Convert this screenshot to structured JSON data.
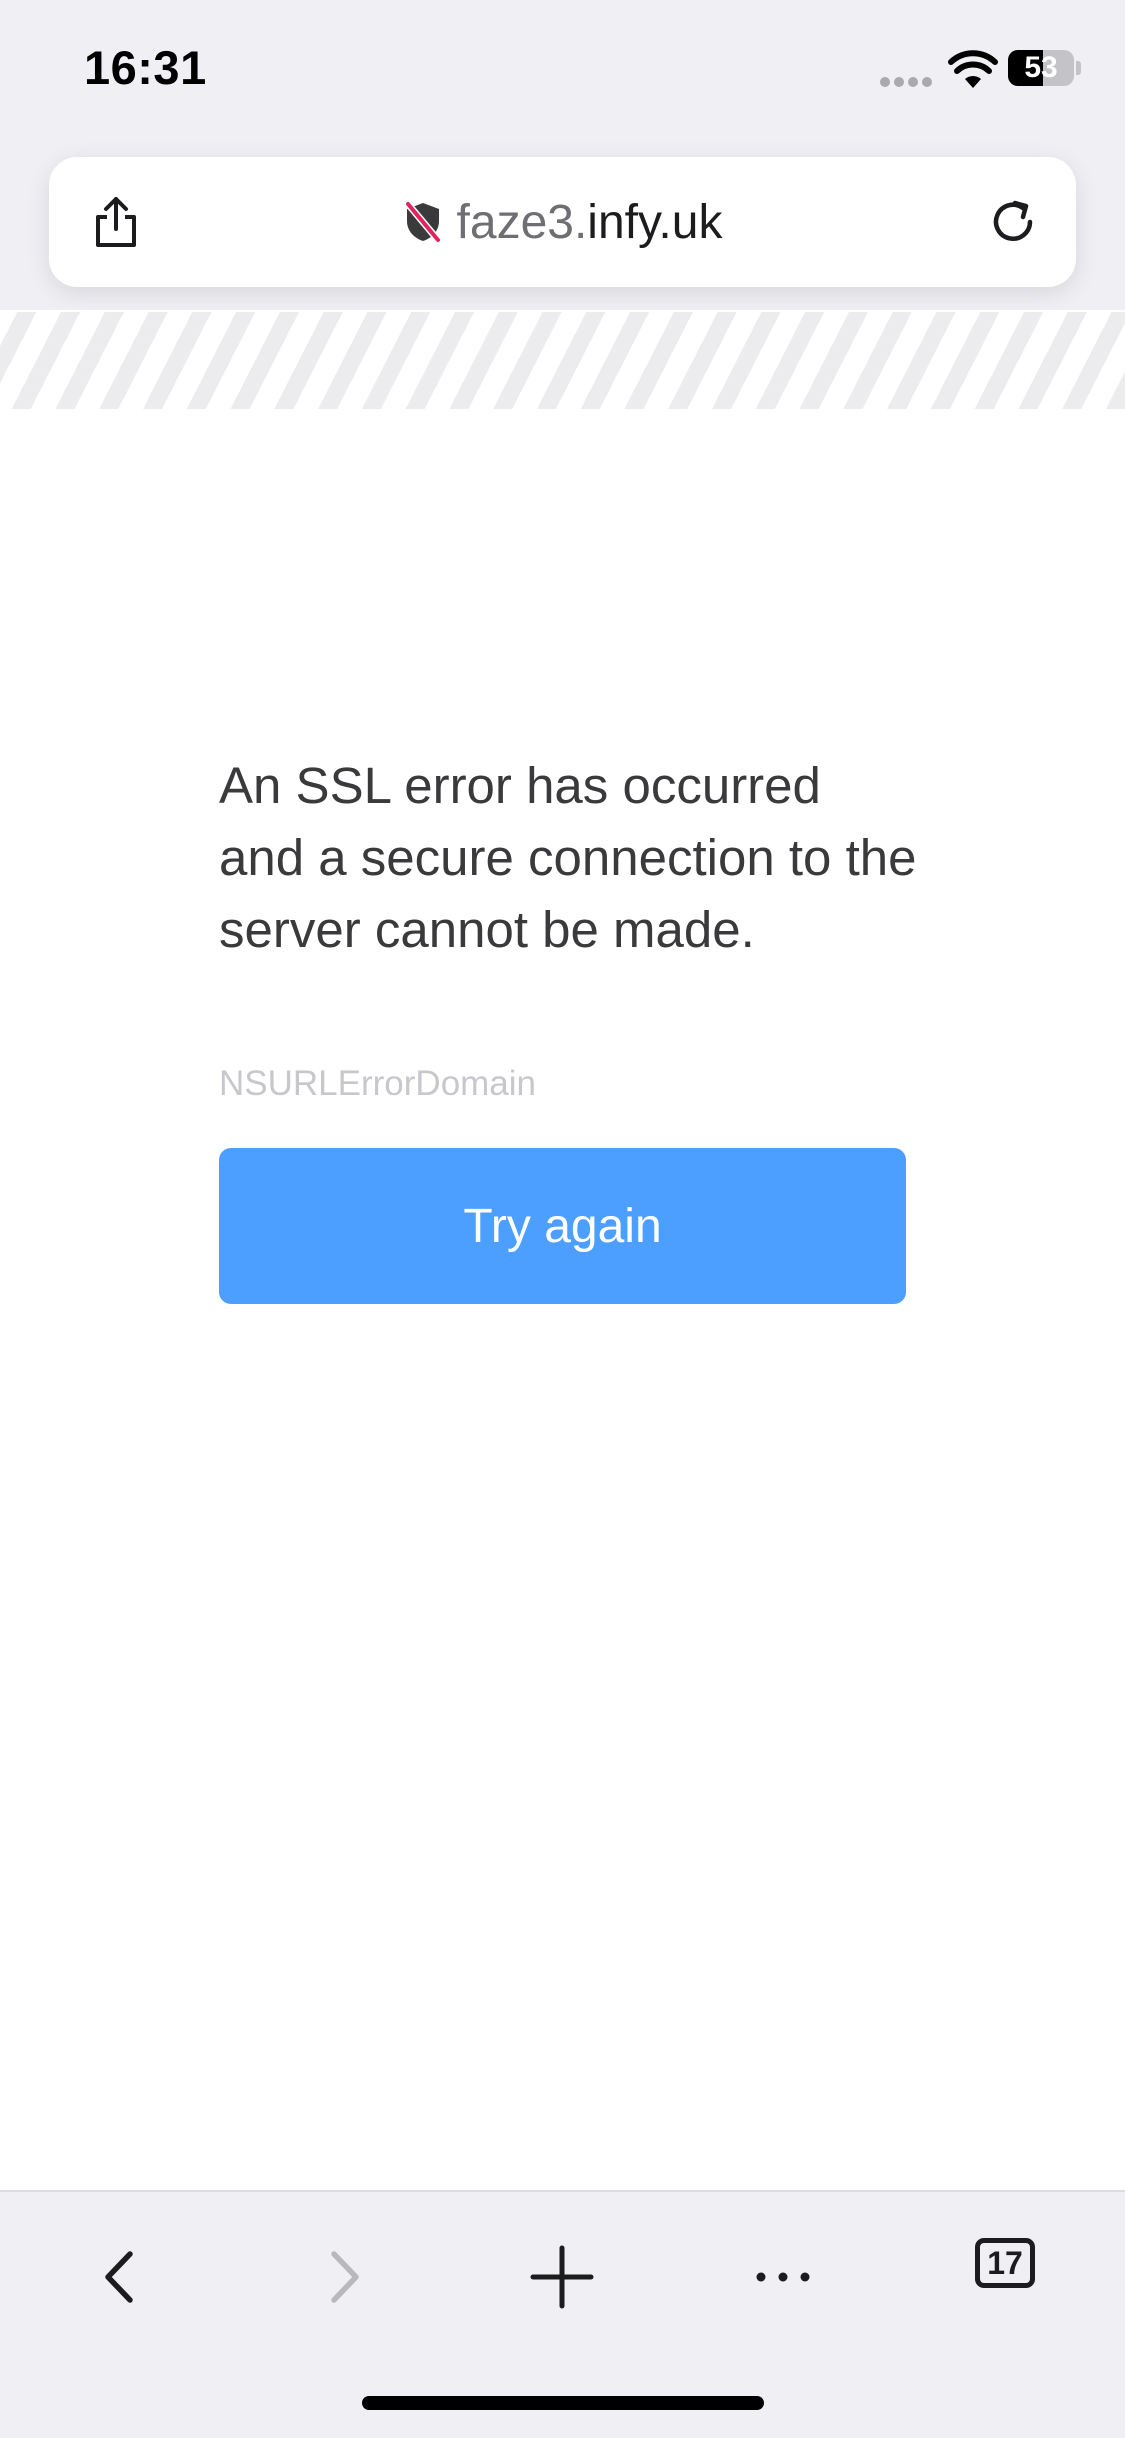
{
  "status_bar": {
    "time": "16:31",
    "battery_level": "53",
    "battery_fraction": 0.53
  },
  "address_bar": {
    "url_prefix": "faze3.",
    "url_domain": "infy.uk",
    "share_icon": "share-icon",
    "security_icon": "shield-slash-icon",
    "reload_icon": "reload-icon"
  },
  "error": {
    "message": "An SSL error has occurred and a secure connection to the server cannot be made.",
    "domain": "NSURLErrorDomain",
    "button_label": "Try again"
  },
  "toolbar": {
    "tab_count": "17",
    "icons": [
      "back-icon",
      "forward-icon",
      "new-tab-icon",
      "more-icon",
      "tabs-icon"
    ]
  },
  "colors": {
    "accent": "#4c9ffe",
    "chrome_background": "#efeff4",
    "security_icon": "#3a3a3c",
    "security_slash": "#e0245e"
  }
}
